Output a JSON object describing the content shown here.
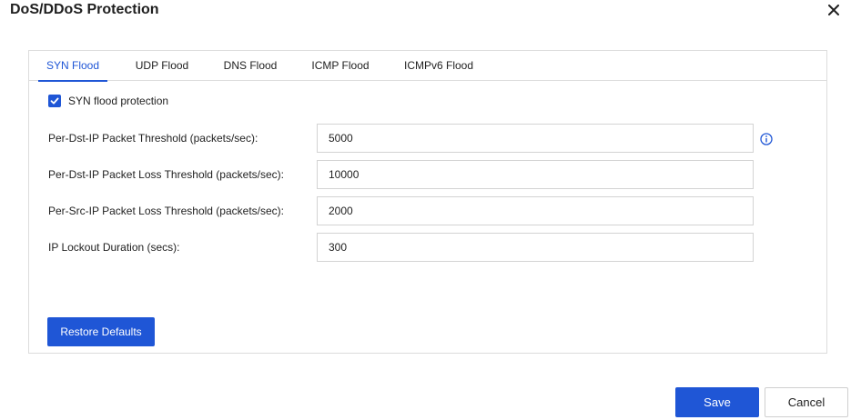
{
  "dialog": {
    "title": "DoS/DDoS Protection",
    "close_icon": "close-icon"
  },
  "tabs": [
    {
      "label": "SYN Flood",
      "active": true
    },
    {
      "label": "UDP Flood",
      "active": false
    },
    {
      "label": "DNS Flood",
      "active": false
    },
    {
      "label": "ICMP Flood",
      "active": false
    },
    {
      "label": "ICMPv6 Flood",
      "active": false
    }
  ],
  "syn": {
    "protection_label": "SYN flood protection",
    "protection_checked": true,
    "fields": [
      {
        "label": "Per-Dst-IP Packet Threshold (packets/sec):",
        "value": "5000"
      },
      {
        "label": "Per-Dst-IP Packet Loss Threshold (packets/sec):",
        "value": "10000"
      },
      {
        "label": "Per-Src-IP Packet Loss Threshold (packets/sec):",
        "value": "2000"
      },
      {
        "label": "IP Lockout Duration (secs):",
        "value": "300"
      }
    ],
    "restore_label": "Restore Defaults"
  },
  "footer": {
    "save_label": "Save",
    "cancel_label": "Cancel"
  },
  "colors": {
    "accent": "#1f56d6",
    "border": "#dcdcdc"
  }
}
